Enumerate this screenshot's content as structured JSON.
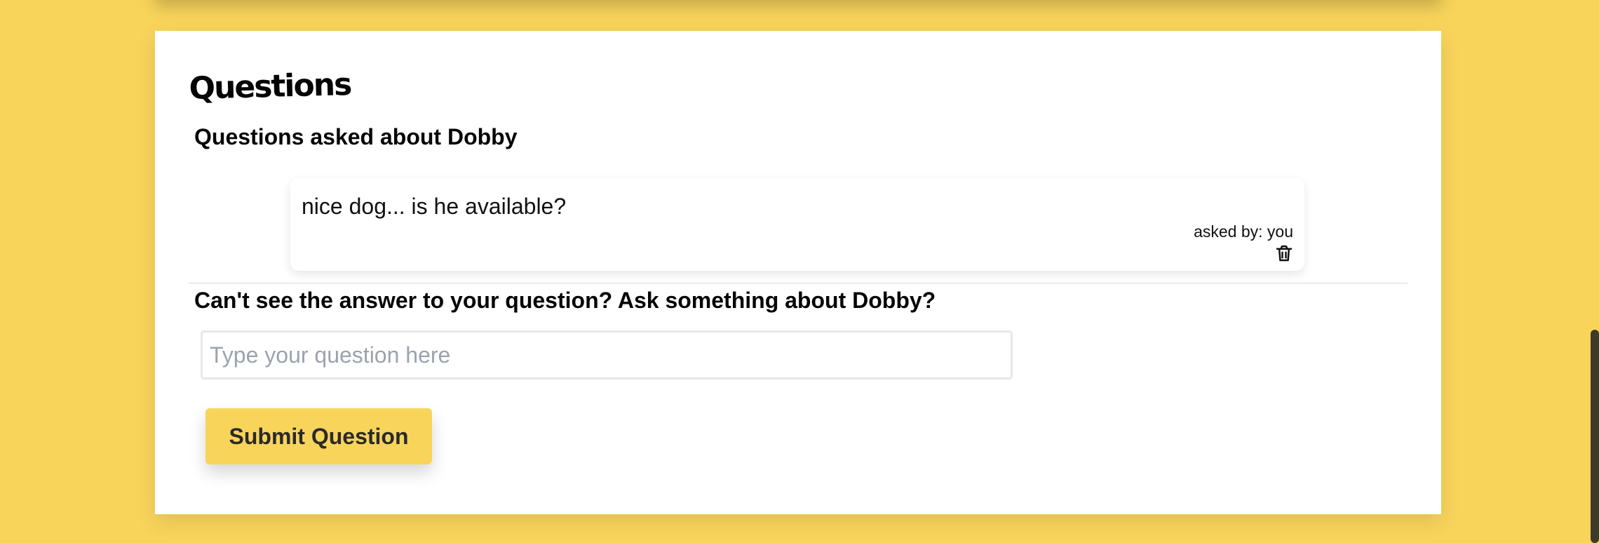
{
  "colors": {
    "page_background": "#f8d45b",
    "card_background": "#ffffff",
    "button_background": "#f8d45b",
    "placeholder_text": "#9ca3af"
  },
  "questions_section": {
    "title": "Questions",
    "subtitle": "Questions asked about Dobby",
    "items": [
      {
        "text": "nice dog... is he available?",
        "asked_by": "asked by: you",
        "delete_icon": "trash-icon"
      }
    ]
  },
  "ask_form": {
    "heading": "Can't see the answer to your question? Ask something about Dobby?",
    "input_value": "",
    "input_placeholder": "Type your question here",
    "submit_label": "Submit Question"
  }
}
